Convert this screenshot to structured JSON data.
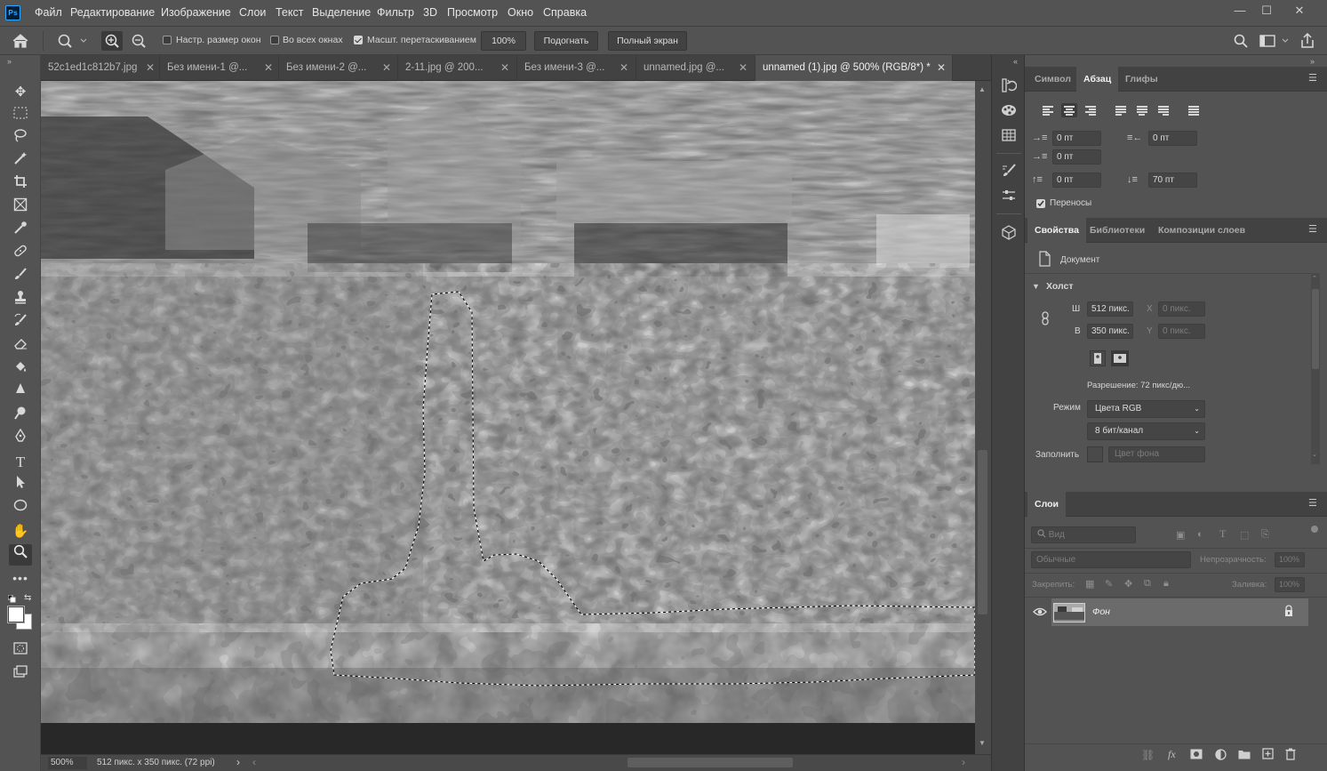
{
  "app": {
    "logo": "Ps"
  },
  "menu": [
    "Файл",
    "Редактирование",
    "Изображение",
    "Слои",
    "Текст",
    "Выделение",
    "Фильтр",
    "3D",
    "Просмотр",
    "Окно",
    "Справка"
  ],
  "window_controls": {
    "minimize": "—",
    "maximize": "☐",
    "close": "✕"
  },
  "options": {
    "resize_windows_label": "Настр. размер окон",
    "resize_windows_checked": false,
    "all_windows_label": "Во всех окнах",
    "all_windows_checked": false,
    "scrubby_zoom_label": "Масшт. перетаскиванием",
    "scrubby_zoom_checked": true,
    "zoom_value": "100%",
    "fit_label": "Подогнать",
    "fullscreen_label": "Полный экран"
  },
  "tabs": [
    {
      "label": "52c1ed1c812b7.jpg",
      "active": false
    },
    {
      "label": "Без имени-1 @...",
      "active": false
    },
    {
      "label": "Без имени-2 @...",
      "active": false
    },
    {
      "label": "2-11.jpg @ 200...",
      "active": false
    },
    {
      "label": "Без имени-3 @...",
      "active": false
    },
    {
      "label": "unnamed.jpg @...",
      "active": false
    },
    {
      "label": "unnamed (1).jpg @ 500% (RGB/8*) *",
      "active": true
    }
  ],
  "status": {
    "zoom": "500%",
    "doc_info": "512 пикс. x 350 пикс. (72 ppi)",
    "arrow": "›"
  },
  "paragraph_panel": {
    "tabs": [
      "Символ",
      "Абзац",
      "Глифы"
    ],
    "active_tab": "Абзац",
    "indent_left": "0 пт",
    "indent_right": "0 пт",
    "indent_first": "0 пт",
    "space_before": "0 пт",
    "space_after": "70 пт",
    "hyphenate_label": "Переносы",
    "hyphenate_checked": true
  },
  "properties_panel": {
    "tabs": [
      "Свойства",
      "Библиотеки",
      "Композиции слоев"
    ],
    "active_tab": "Свойства",
    "doc_label": "Документ",
    "section": "Холст",
    "w_label": "Ш",
    "w_value": "512 пикс.",
    "h_label": "В",
    "h_value": "350 пикс.",
    "x_label": "X",
    "x_value": "0 пикс.",
    "y_label": "Y",
    "y_value": "0 пикс.",
    "resolution": "Разрешение: 72 пикс/дю...",
    "mode_label": "Режим",
    "mode_value": "Цвета RGB",
    "depth_value": "8 бит/канал",
    "fill_label": "Заполнить",
    "fill_value": "Цвет фона"
  },
  "layers_panel": {
    "tab": "Слои",
    "search_placeholder": "Вид",
    "blend_mode": "Обычные",
    "opacity_label": "Непрозрачность:",
    "opacity_value": "100%",
    "lock_label": "Закрепить:",
    "fill_label": "Заливка:",
    "fill_value": "100%",
    "layers": [
      {
        "name": "Фон",
        "visible": true,
        "locked": true
      }
    ]
  },
  "colors": {
    "panel_bg": "#535353",
    "dark_bg": "#424242",
    "canvas_bg": "#282828"
  }
}
